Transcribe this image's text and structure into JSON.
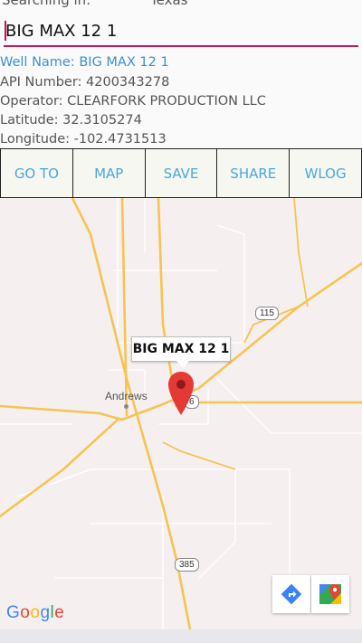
{
  "header": {
    "searching_label": "Searching in:",
    "searching_value": "Texas"
  },
  "search": {
    "value": "BIG MAX 12 1",
    "placeholder": ""
  },
  "well": {
    "name": "Well Name: BIG MAX 12 1",
    "api": "API Number: 4200343278",
    "operator": "Operator: CLEARFORK PRODUCTION LLC",
    "latitude": "Latitude: 32.3105274",
    "longitude": "Longitude: -102.4731513"
  },
  "buttons": {
    "goto": "GO TO",
    "map": "MAP",
    "save": "SAVE",
    "share": "SHARE",
    "wlog": "WLOG"
  },
  "map": {
    "callout": "BIG MAX 12 1",
    "town": "Andrews",
    "shield_115": "115",
    "shield_385": "385",
    "shield_176": "6",
    "google_letters": [
      "G",
      "o",
      "o",
      "g",
      "l",
      "e"
    ]
  },
  "colors": {
    "accent": "#c2185b",
    "link": "#3d8fd6",
    "button_text": "#4aa8d8",
    "road": "#f5c451",
    "pin": "#e53935"
  }
}
